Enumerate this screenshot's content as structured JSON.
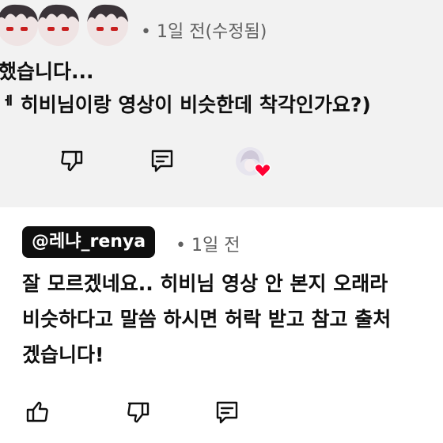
{
  "top_comment": {
    "meta": "• 1일 전(수정됨)",
    "lines": [
      "했습니다...",
      "ᅦ 히비님이랑 영상이 비슷한데 착각인가요?)"
    ],
    "actions": {
      "dislike_icon": "thumbs-down-icon",
      "reply_icon": "reply-icon",
      "creator_heart_icon": "creator-heart-icon"
    }
  },
  "reply_comment": {
    "author_handle": "@레냐_renya",
    "meta": "• 1일 전",
    "lines": [
      "잘 모르겠네요.. 히비님 영상 안 본지 오래라",
      "비슷하다고 말씀 하시면 허락 받고 참고 출처",
      "겠습니다!"
    ],
    "actions": {
      "like_icon": "thumbs-up-icon",
      "dislike_icon": "thumbs-down-icon",
      "reply_icon": "reply-icon"
    }
  },
  "colors": {
    "top_background": "#f2f2f2",
    "handle_background": "#0f0f0f",
    "meta_text": "#606060",
    "heart": "#ff0033"
  }
}
